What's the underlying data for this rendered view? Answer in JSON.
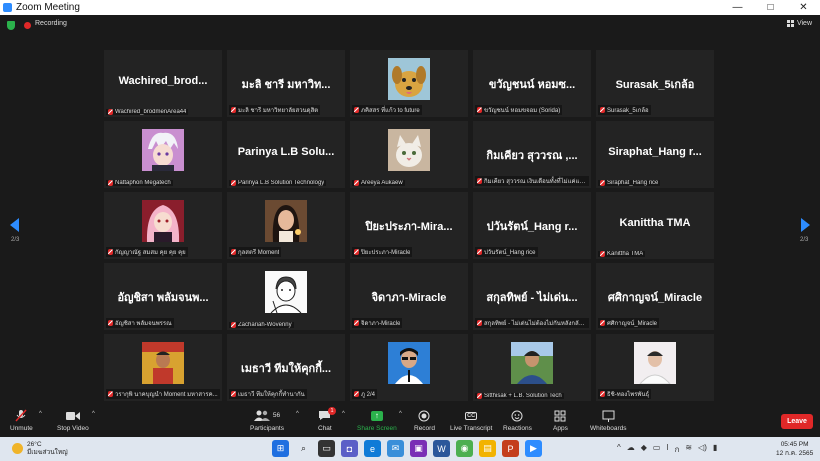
{
  "window": {
    "title": "Zoom Meeting",
    "controls": [
      "—",
      "□",
      "✕"
    ]
  },
  "topbar": {
    "recording_label": "Recording",
    "view_label": "View"
  },
  "pager": {
    "left": "2/3",
    "right": "2/3"
  },
  "tiles": [
    {
      "big": "Wachired_brod...",
      "name": "Wachired_brodmenArea44",
      "photo": ""
    },
    {
      "big": "มะลิ ชารี มหาวิท...",
      "name": "มะลิ ชารี มหาวิทยาลัยสวนดุสิต",
      "photo": ""
    },
    {
      "big": "",
      "name": "ภคิสสร ที่แก้ว to future",
      "photo": "dog"
    },
    {
      "big": "ขวัญชนน์ หอมซ...",
      "name": "ขวัญชนน์ หอมขจอม (Sorida)",
      "photo": ""
    },
    {
      "big": "Surasak_5เกล้อ",
      "name": "Surasak_5เกล้อ",
      "photo": ""
    },
    {
      "big": "",
      "name": "Nattaphon Megatech",
      "photo": "anime-white"
    },
    {
      "big": "Parinya L.B Solu...",
      "name": "Parinya L.B Solution Technology",
      "photo": ""
    },
    {
      "big": "",
      "name": "Areeya Aukaew",
      "photo": "cat"
    },
    {
      "big": "กิมเคียว สุววรณ ,...",
      "name": "กิมเคียว สุววรณ เงินเดือนทั้งที่ไม่แค่แทส...",
      "photo": ""
    },
    {
      "big": "Siraphat_Hang r...",
      "name": "Siraphat_Hang rice",
      "photo": ""
    },
    {
      "big": "",
      "name": "กัญญาณัฐ สมสม คุย คุย คุย",
      "photo": "anime-pink"
    },
    {
      "big": "",
      "name": "กุลสตรี Moment",
      "photo": "woman"
    },
    {
      "big": "ปิยะประภา-Mira...",
      "name": "ปิยะประภา-Miracle",
      "photo": ""
    },
    {
      "big": "ปวันรัตน์_Hang r...",
      "name": "ปวันรัตน์_Hang rice",
      "photo": ""
    },
    {
      "big": "Kanittha TMA",
      "name": "Kanittha TMA",
      "photo": ""
    },
    {
      "big": "อัญชิสา พลัมจนพ...",
      "name": "อัญชิสา พลัมจนพรรณ",
      "photo": ""
    },
    {
      "big": "",
      "name": "Zachariah-Wovenny",
      "photo": "sketch"
    },
    {
      "big": "จิดาภา-Miracle",
      "name": "จิดาภา-Miracle",
      "photo": ""
    },
    {
      "big": "สกุลทิพย์ - ไม่เด่น...",
      "name": "สกุลทิพย์ - ไม่เด่นไม่ต้องไม่กันหลังกลับไป",
      "photo": ""
    },
    {
      "big": "ศศิกาญจน์_Miracle",
      "name": "ศศิกาญจน์_Miracle",
      "photo": ""
    },
    {
      "big": "",
      "name": "วรากุพิ นาคบุญนำ Moment มหาสารค...",
      "photo": "man-flag"
    },
    {
      "big": "เมธาวี ทีมให้คุกกี้...",
      "name": "เมธาวี ทีมให้คุกกี้ทำนากัน",
      "photo": ""
    },
    {
      "big": "",
      "name": "ภู 2/4",
      "photo": "man-blue"
    },
    {
      "big": "",
      "name": "Sitthisak + L.B. Solution Tech",
      "photo": "man-outdoor"
    },
    {
      "big": "",
      "name": "ธิชิ-ทองไพรพันธุ์",
      "photo": "man-white"
    }
  ],
  "controls": {
    "unmute": "Unmute",
    "stop_video": "Stop Video",
    "participants": "Participants",
    "participants_count": "56",
    "chat": "Chat",
    "chat_badge": "1",
    "share_screen": "Share Screen",
    "record": "Record",
    "live_transcript": "Live Transcript",
    "reactions": "Reactions",
    "apps": "Apps",
    "whiteboards": "Whiteboards",
    "leave": "Leave"
  },
  "taskbar": {
    "temp": "26°C",
    "weather": "มีเมฆส่วนใหญ่",
    "time": "05:45 PM",
    "date": "12 ก.ค. 2565"
  },
  "colors": {
    "accent": "#2d8cff",
    "leave": "#e02828",
    "share": "#2bb24c"
  }
}
